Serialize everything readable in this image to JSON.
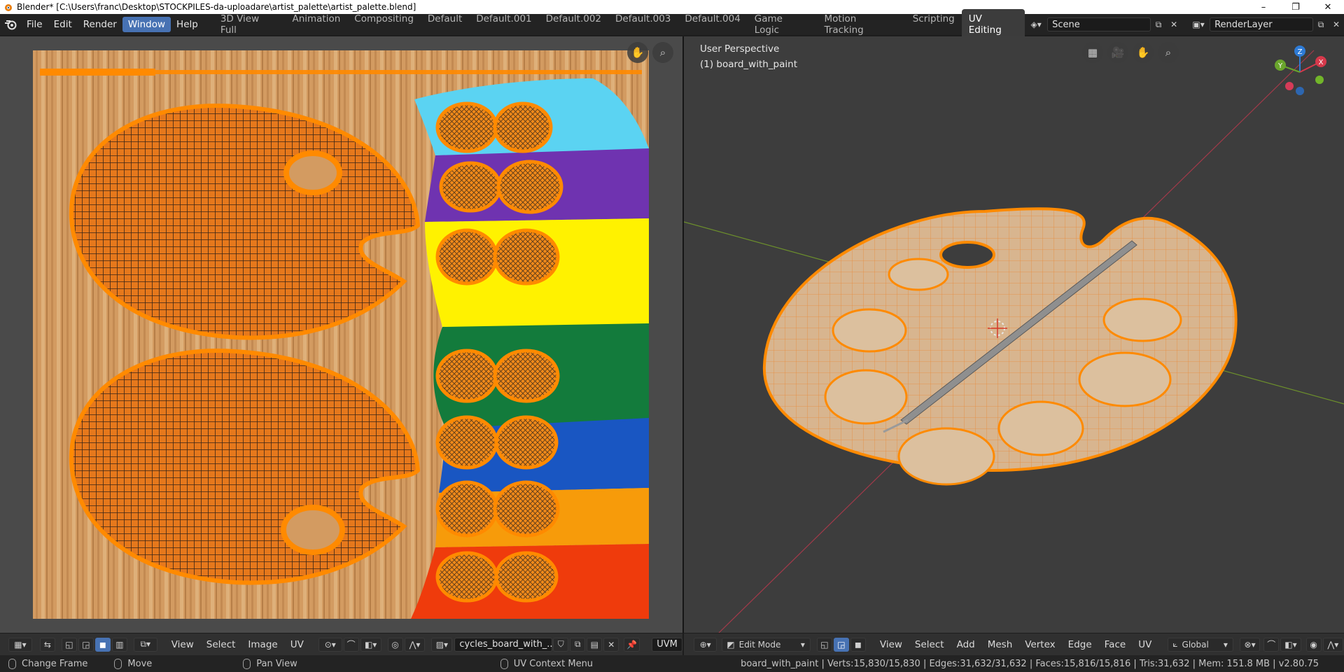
{
  "window": {
    "title": "Blender* [C:\\Users\\franc\\Desktop\\STOCKPILES-da-uploadare\\artist_palette\\artist_palette.blend]",
    "minimize": "–",
    "maximize": "❐",
    "close": "✕"
  },
  "menu": {
    "file": "File",
    "edit": "Edit",
    "render": "Render",
    "window": "Window",
    "help": "Help"
  },
  "workspaces": [
    {
      "label": "3D View Full"
    },
    {
      "label": "Animation"
    },
    {
      "label": "Compositing"
    },
    {
      "label": "Default"
    },
    {
      "label": "Default.001"
    },
    {
      "label": "Default.002"
    },
    {
      "label": "Default.003"
    },
    {
      "label": "Default.004"
    },
    {
      "label": "Game Logic"
    },
    {
      "label": "Motion Tracking"
    },
    {
      "label": "Scripting"
    },
    {
      "label": "UV Editing"
    }
  ],
  "scene": {
    "name": "Scene",
    "render_layer": "RenderLayer"
  },
  "viewport": {
    "perspective": "User Perspective",
    "object": "(1) board_with_paint",
    "gizmo_axes": {
      "x": "X",
      "y": "Y",
      "z": "Z"
    }
  },
  "uv_header": {
    "view": "View",
    "select": "Select",
    "image": "Image",
    "uv": "UV",
    "image_name": "cycles_board_with_...",
    "uv_map": "UVM"
  },
  "viewport_header": {
    "mode": "Edit Mode",
    "view": "View",
    "select": "Select",
    "add": "Add",
    "mesh": "Mesh",
    "vertex": "Vertex",
    "edge": "Edge",
    "face": "Face",
    "uv": "UV",
    "orientation": "Global"
  },
  "status": {
    "change_frame": "Change Frame",
    "move": "Move",
    "pan_view": "Pan View",
    "uv_context_menu": "UV Context Menu",
    "stats": "board_with_paint | Verts:15,830/15,830 | Edges:31,632/31,632 | Faces:15,816/15,816 | Tris:31,632 | Mem: 151.8 MB | v2.80.75"
  },
  "colors": {
    "accent": "#4772b3",
    "selection_orange": "#ff8a00",
    "cyan": "#5bd3f2",
    "purple": "#6f33b0",
    "yellow": "#fff200",
    "green": "#137b3c",
    "blue": "#1956c2",
    "orange": "#f79b0a",
    "red": "#ef3b0c",
    "wood": "#d39b61"
  }
}
